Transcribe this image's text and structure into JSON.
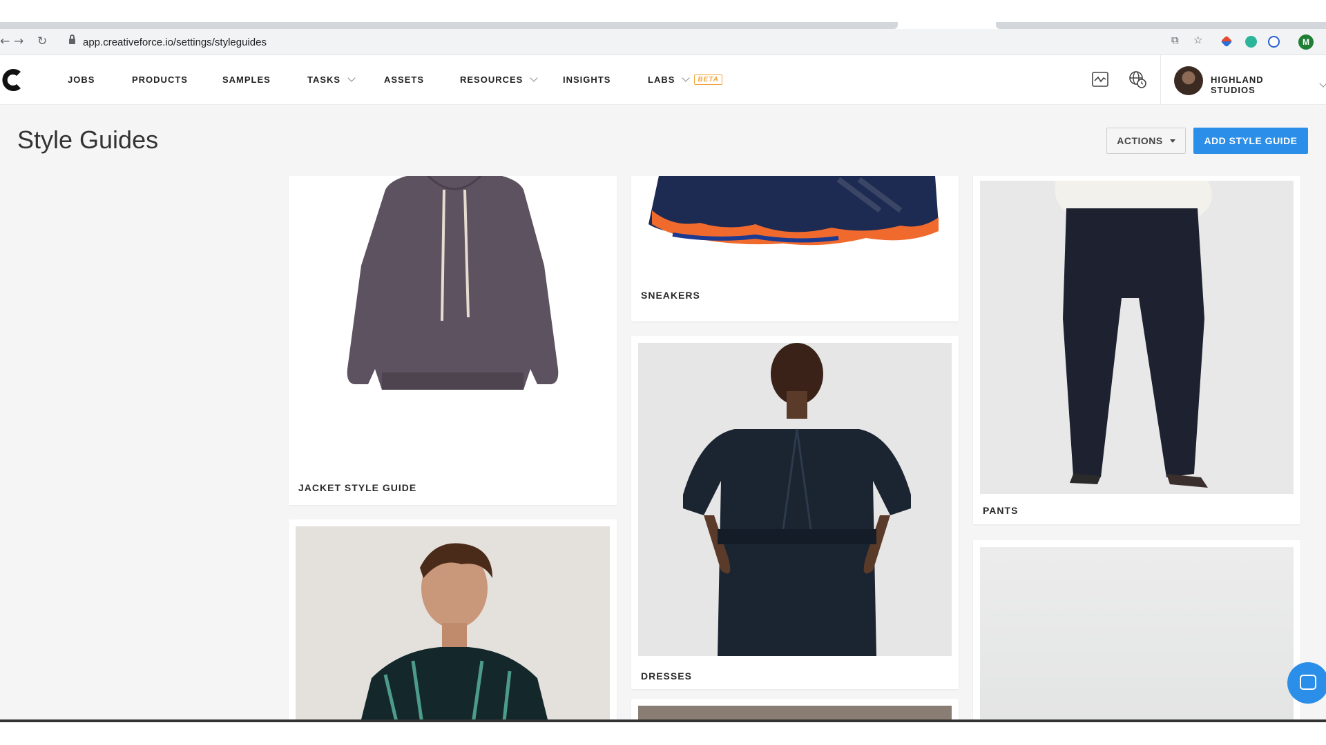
{
  "browser": {
    "url": "app.creativeforce.io/settings/styleguides",
    "profile_initial": "M"
  },
  "nav": {
    "items": [
      {
        "label": "JOBS"
      },
      {
        "label": "PRODUCTS"
      },
      {
        "label": "SAMPLES"
      },
      {
        "label": "TASKS"
      },
      {
        "label": "ASSETS"
      },
      {
        "label": "RESOURCES"
      },
      {
        "label": "INSIGHTS"
      },
      {
        "label": "LABS"
      }
    ],
    "beta_badge": "BETA",
    "studio_name": "HIGHLAND STUDIOS"
  },
  "page": {
    "title": "Style Guides",
    "actions_label": "ACTIONS",
    "add_label": "ADD STYLE GUIDE"
  },
  "cards": [
    {
      "label": "JACKET STYLE GUIDE"
    },
    {
      "label": "SNEAKERS"
    },
    {
      "label": "PANTS"
    },
    {
      "label": "DRESSES"
    }
  ],
  "colors": {
    "accent": "#2b8ee8",
    "beta": "#f0a43a",
    "page_bg": "#f5f5f5"
  }
}
